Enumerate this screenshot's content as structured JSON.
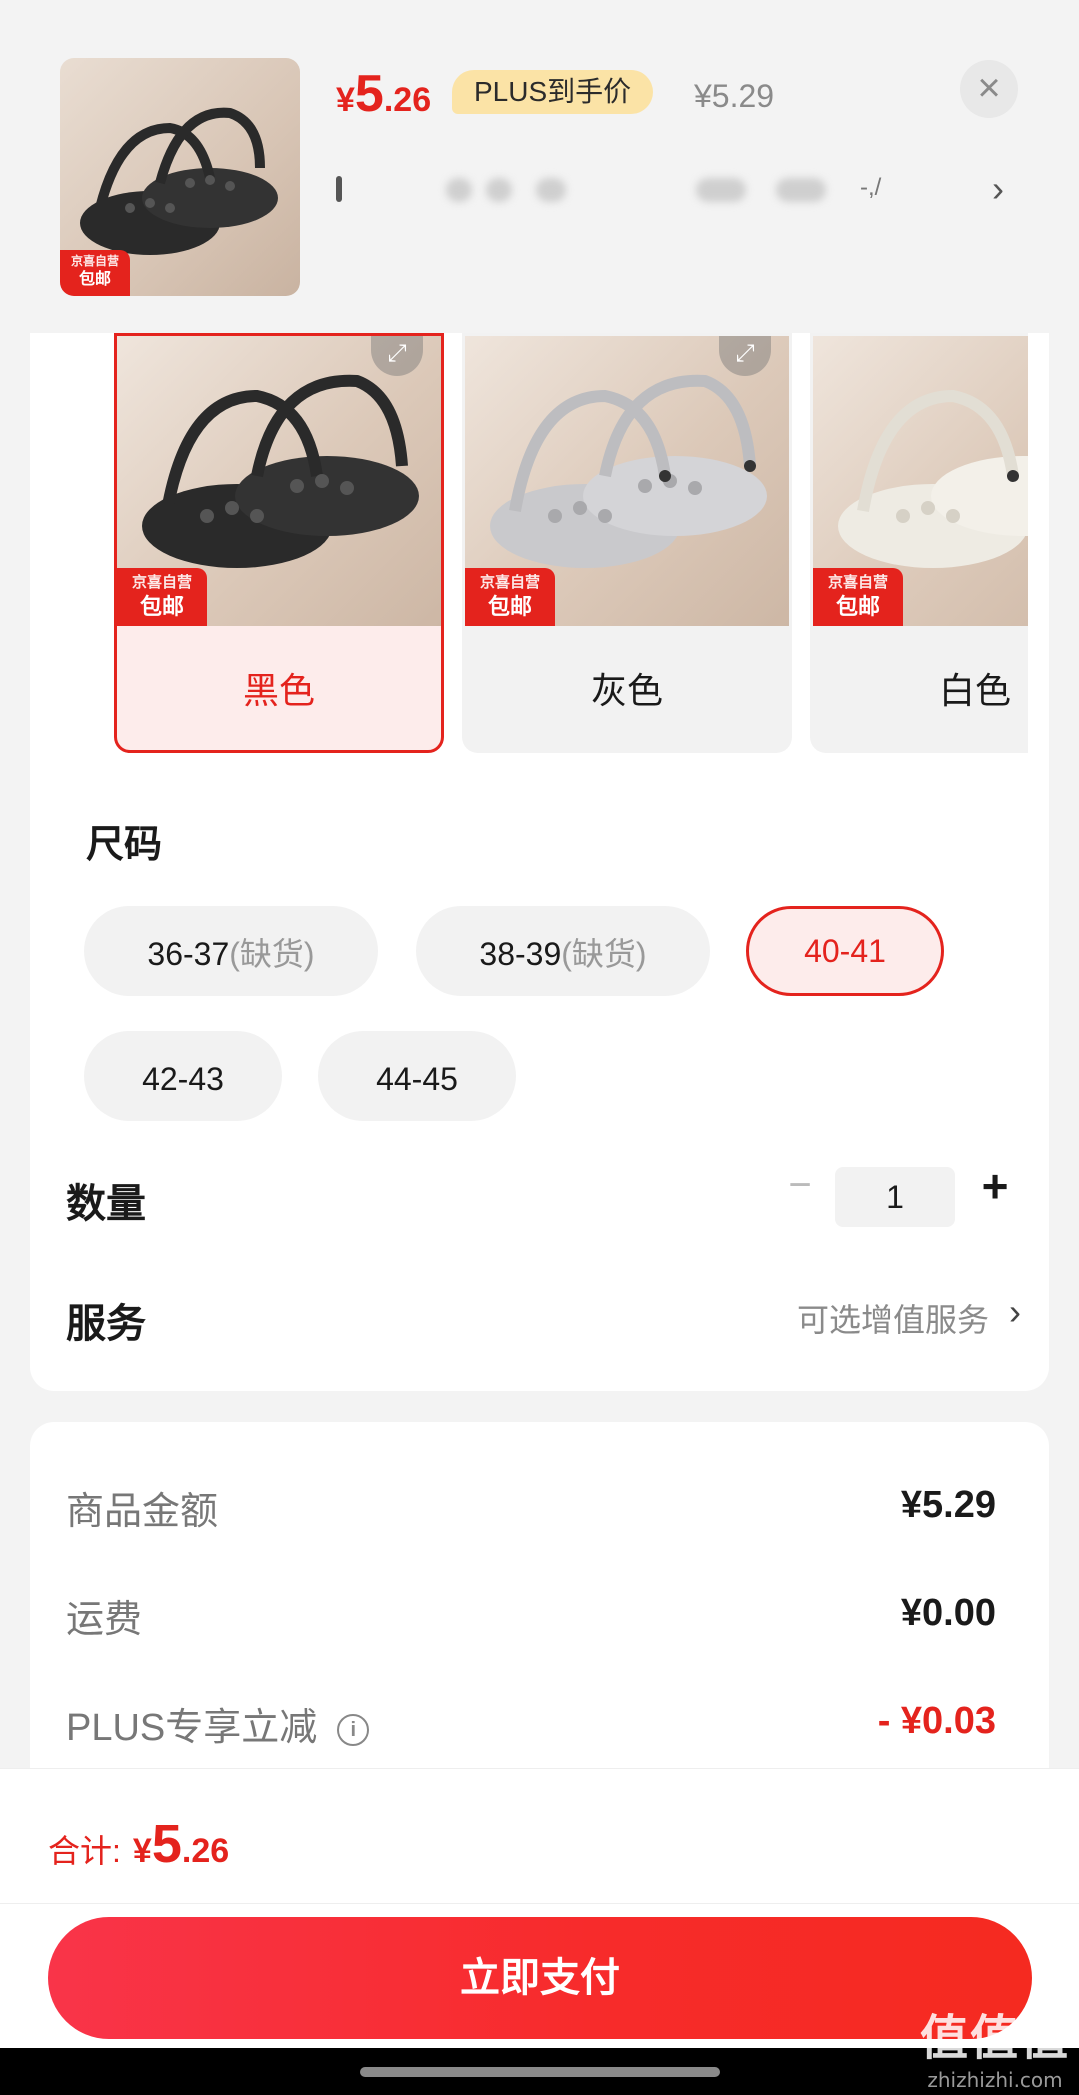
{
  "product": {
    "price_yen": "¥",
    "price_int": "5",
    "price_dec": ".26",
    "plus_badge": "PLUS到手价",
    "original_price": "¥5.29",
    "title_open_bracket": "[",
    "title_tail": "-,/",
    "thumb_tag_line1": "京喜自营",
    "thumb_tag_line2": "包邮"
  },
  "colors": {
    "items": [
      {
        "label": "黑色",
        "tag1": "京喜自营",
        "tag2": "包邮",
        "shoe_color": "#2a2a2a"
      },
      {
        "label": "灰色",
        "tag1": "京喜自营",
        "tag2": "包邮",
        "shoe_color": "#c9c9cc"
      },
      {
        "label": "白色",
        "tag1": "京喜自营",
        "tag2": "包邮",
        "shoe_color": "#eeebe3"
      }
    ],
    "selected": "黑色"
  },
  "size": {
    "title": "尺码",
    "options": [
      {
        "label": "36-37",
        "suffix": "(缺货)"
      },
      {
        "label": "38-39",
        "suffix": "(缺货)"
      },
      {
        "label": "40-41",
        "suffix": ""
      },
      {
        "label": "42-43",
        "suffix": ""
      },
      {
        "label": "44-45",
        "suffix": ""
      }
    ],
    "selected": "40-41"
  },
  "quantity": {
    "label": "数量",
    "minus": "−",
    "value": "1",
    "plus": "+"
  },
  "service": {
    "label": "服务",
    "hint": "可选增值服务",
    "arrow": "›"
  },
  "costs": {
    "goods_label": "商品金额",
    "goods_value": "¥5.29",
    "shipping_label": "运费",
    "shipping_value": "¥0.00",
    "plus_label": "PLUS专享立减",
    "plus_info": "i",
    "plus_value": "- ¥0.03"
  },
  "total": {
    "label": "合计:",
    "yen": "¥",
    "int": "5",
    "dec": ".26"
  },
  "pay_button": "立即支付",
  "close_icon": "×",
  "title_arrow": "›",
  "watermark": {
    "line1": "值值值",
    "line2": "zhizhizhi.com"
  },
  "theme": {
    "accent": "#e4231d",
    "badge_bg": "#fbe3a6"
  }
}
